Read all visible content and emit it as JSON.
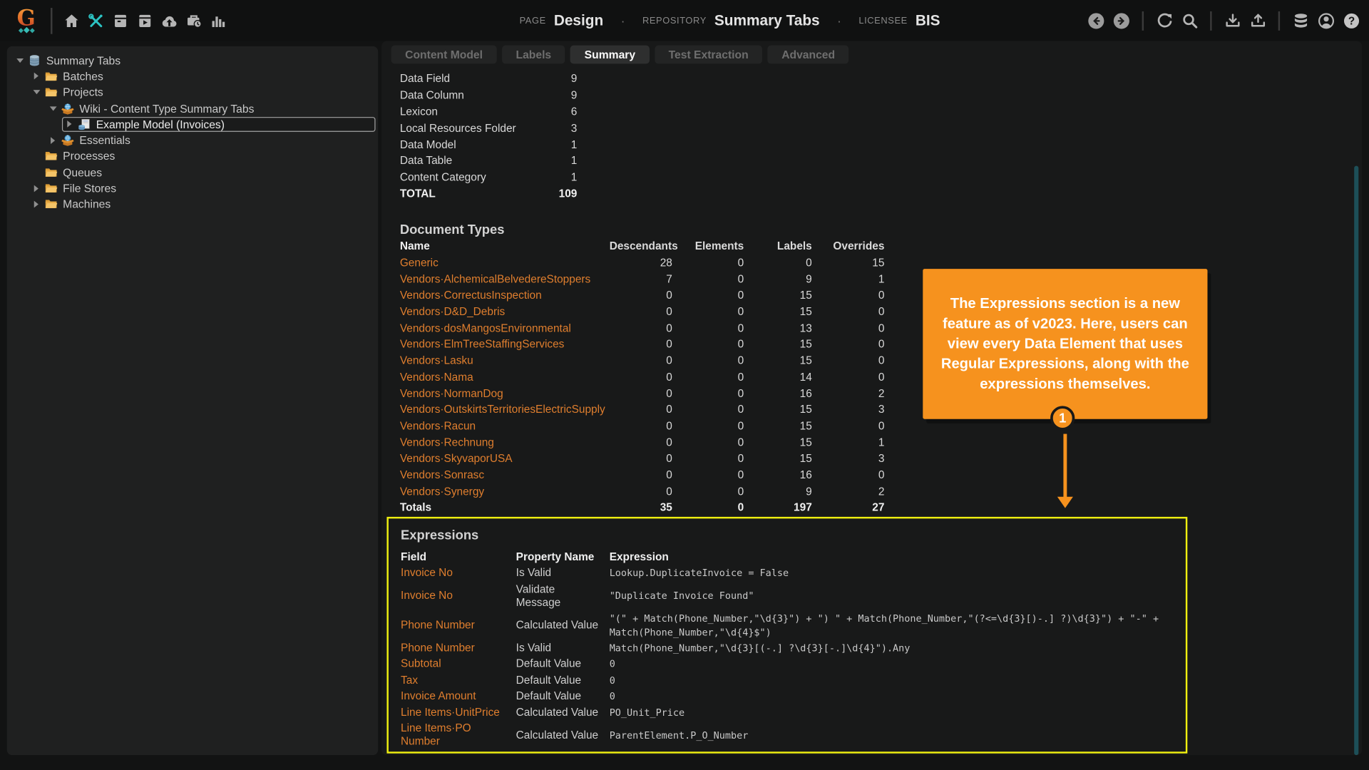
{
  "topbar": {
    "brand_letter": "G",
    "nav_icons": [
      "home-icon",
      "tools-icon",
      "batches-icon",
      "export-box-icon",
      "cloud-upload-icon",
      "jobs-icon",
      "stats-icon"
    ],
    "page_label": "PAGE",
    "page_value": "Design",
    "repository_label": "REPOSITORY",
    "repository_value": "Summary Tabs",
    "licensee_label": "LICENSEE",
    "licensee_value": "BIS",
    "separator": "·",
    "right_icons": [
      "back-icon",
      "forward-icon",
      "refresh-icon",
      "search-icon",
      "download-icon",
      "upload-icon",
      "database-icon",
      "account-icon",
      "help-icon"
    ]
  },
  "tree": {
    "items": [
      {
        "label": "Summary Tabs",
        "level": 0,
        "expander": "expanded",
        "icon": "database-icon",
        "selected": false
      },
      {
        "label": "Batches",
        "level": 1,
        "expander": "collapsed",
        "icon": "folder-icon",
        "selected": false
      },
      {
        "label": "Projects",
        "level": 1,
        "expander": "expanded",
        "icon": "folder-icon",
        "selected": false
      },
      {
        "label": "Wiki - Content Type Summary Tabs",
        "level": 2,
        "expander": "expanded",
        "icon": "package-icon",
        "selected": false
      },
      {
        "label": "Example Model (Invoices)",
        "level": 3,
        "expander": "collapsed",
        "icon": "model-icon",
        "selected": true
      },
      {
        "label": "Essentials",
        "level": 2,
        "expander": "collapsed",
        "icon": "package-icon",
        "selected": false
      },
      {
        "label": "Processes",
        "level": 1,
        "expander": "none",
        "icon": "folder-icon",
        "selected": false
      },
      {
        "label": "Queues",
        "level": 1,
        "expander": "none",
        "icon": "folder-icon",
        "selected": false
      },
      {
        "label": "File Stores",
        "level": 1,
        "expander": "collapsed",
        "icon": "folder-icon",
        "selected": false
      },
      {
        "label": "Machines",
        "level": 1,
        "expander": "collapsed",
        "icon": "folder-icon",
        "selected": false
      }
    ]
  },
  "tabs": [
    {
      "label": "Content Model",
      "active": false
    },
    {
      "label": "Labels",
      "active": false
    },
    {
      "label": "Summary",
      "active": true
    },
    {
      "label": "Test Extraction",
      "active": false
    },
    {
      "label": "Advanced",
      "active": false
    }
  ],
  "summary": {
    "counts": {
      "rows": [
        {
          "label": "Data Field",
          "count": "9"
        },
        {
          "label": "Data Column",
          "count": "9"
        },
        {
          "label": "Lexicon",
          "count": "6"
        },
        {
          "label": "Local Resources Folder",
          "count": "3"
        },
        {
          "label": "Data Model",
          "count": "1"
        },
        {
          "label": "Data Table",
          "count": "1"
        },
        {
          "label": "Content Category",
          "count": "1"
        }
      ],
      "total_label": "TOTAL",
      "total": "109"
    },
    "document_types": {
      "title": "Document Types",
      "columns": [
        "Name",
        "Descendants",
        "Elements",
        "Labels",
        "Overrides"
      ],
      "rows": [
        {
          "name": "Generic",
          "values": [
            "28",
            "0",
            "0",
            "15"
          ]
        },
        {
          "name": "Vendors·AlchemicalBelvedereStoppers",
          "values": [
            "7",
            "0",
            "9",
            "1"
          ]
        },
        {
          "name": "Vendors·CorrectusInspection",
          "values": [
            "0",
            "0",
            "15",
            "0"
          ]
        },
        {
          "name": "Vendors·D&D_Debris",
          "values": [
            "0",
            "0",
            "15",
            "0"
          ]
        },
        {
          "name": "Vendors·dosMangosEnvironmental",
          "values": [
            "0",
            "0",
            "13",
            "0"
          ]
        },
        {
          "name": "Vendors·ElmTreeStaffingServices",
          "values": [
            "0",
            "0",
            "15",
            "0"
          ]
        },
        {
          "name": "Vendors·Lasku",
          "values": [
            "0",
            "0",
            "15",
            "0"
          ]
        },
        {
          "name": "Vendors·Nama",
          "values": [
            "0",
            "0",
            "14",
            "0"
          ]
        },
        {
          "name": "Vendors·NormanDog",
          "values": [
            "0",
            "0",
            "16",
            "2"
          ]
        },
        {
          "name": "Vendors·OutskirtsTerritoriesElectricSupply",
          "values": [
            "0",
            "0",
            "15",
            "3"
          ]
        },
        {
          "name": "Vendors·Racun",
          "values": [
            "0",
            "0",
            "15",
            "0"
          ]
        },
        {
          "name": "Vendors·Rechnung",
          "values": [
            "0",
            "0",
            "15",
            "1"
          ]
        },
        {
          "name": "Vendors·SkyvaporUSA",
          "values": [
            "0",
            "0",
            "15",
            "3"
          ]
        },
        {
          "name": "Vendors·Sonrasc",
          "values": [
            "0",
            "0",
            "16",
            "0"
          ]
        },
        {
          "name": "Vendors·Synergy",
          "values": [
            "0",
            "0",
            "9",
            "2"
          ]
        }
      ],
      "totals": {
        "label": "Totals",
        "values": [
          "35",
          "0",
          "197",
          "27"
        ]
      }
    },
    "expressions": {
      "title": "Expressions",
      "columns": [
        "Field",
        "Property Name",
        "Expression"
      ],
      "rows": [
        {
          "field": "Invoice No",
          "property": "Is Valid",
          "expression": "Lookup.DuplicateInvoice = False"
        },
        {
          "field": "Invoice No",
          "property": "Validate\nMessage",
          "expression": "\"Duplicate Invoice Found\""
        },
        {
          "field": "Phone Number",
          "property": "Calculated Value",
          "expression": "\"(\" + Match(Phone_Number,\"\\d{3}\") + \") \" + Match(Phone_Number,\"(?<=\\d{3}[)-.] ?)\\d{3}\") + \"-\" + Match(Phone_Number,\"\\d{4}$\")"
        },
        {
          "field": "Phone Number",
          "property": "Is Valid",
          "expression": "Match(Phone_Number,\"\\d{3}[(-.] ?\\d{3}[-.]\\d{4}\").Any"
        },
        {
          "field": "Subtotal",
          "property": "Default Value",
          "expression": "0"
        },
        {
          "field": "Tax",
          "property": "Default Value",
          "expression": "0"
        },
        {
          "field": "Invoice Amount",
          "property": "Default Value",
          "expression": "0"
        },
        {
          "field": "Line Items·UnitPrice",
          "property": "Calculated Value",
          "expression": "PO_Unit_Price"
        },
        {
          "field": "Line Items·PO\nNumber",
          "property": "Calculated Value",
          "expression": "ParentElement.P_O_Number"
        }
      ]
    }
  },
  "callout": {
    "text": "The Expressions section is a new feature as of v2023. Here, users can view every Data Element that uses Regular Expressions, along with the expressions themselves.",
    "step": "1"
  },
  "colors": {
    "link_orange": "#DF7E2E",
    "callout_orange": "#F6921E",
    "highlight_yellow": "#EFEF10",
    "scrollbar_teal": "#1D4F58",
    "tools_teal": "#2CC3C3"
  }
}
